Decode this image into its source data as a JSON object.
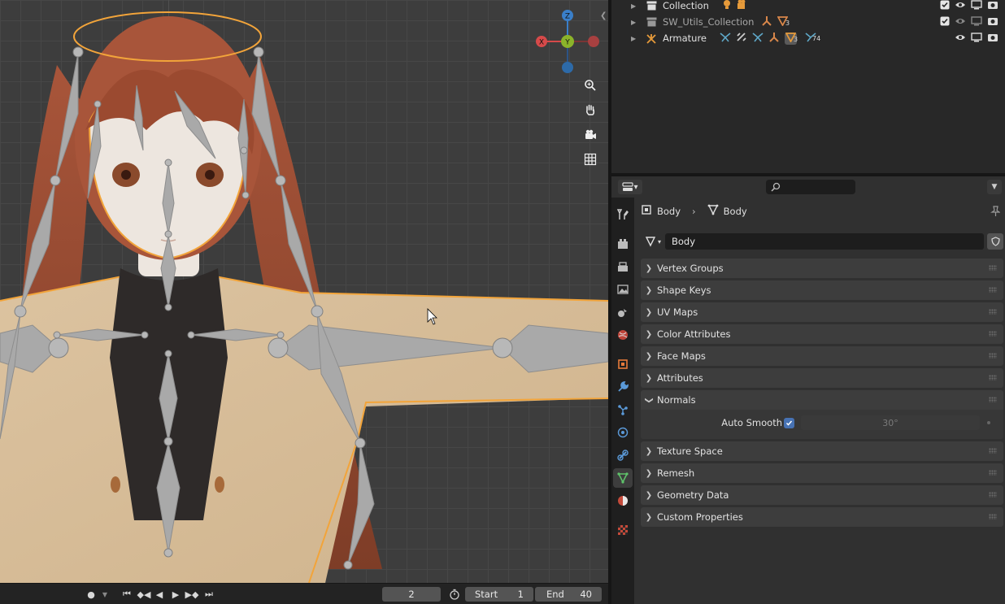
{
  "viewport": {
    "gizmo": {
      "z": "Z",
      "y": "Y",
      "x": "X"
    },
    "axis_colors": {
      "x": "#d64a4a",
      "y": "#8bb32a",
      "z": "#3a7fc9"
    },
    "nav_buttons": [
      "zoom-icon",
      "pan-hand-icon",
      "camera-icon",
      "grid-icon"
    ]
  },
  "timeline": {
    "current_frame": "2",
    "start_label": "Start",
    "start_value": "1",
    "end_label": "End",
    "end_value": "40"
  },
  "outliner": {
    "rows": [
      {
        "label": "Collection",
        "icon": "collection-icon"
      },
      {
        "label": "SW_Utils_Collection",
        "icon": "collection-icon",
        "mod_count": "3"
      },
      {
        "label": "Armature",
        "icon": "armature-icon",
        "mod_count_a": "3",
        "mod_count_b": "74"
      }
    ]
  },
  "properties": {
    "breadcrumb": {
      "object": "Body",
      "data": "Body"
    },
    "mesh_name": "Body",
    "panels": [
      {
        "label": "Vertex Groups",
        "open": false
      },
      {
        "label": "Shape Keys",
        "open": false
      },
      {
        "label": "UV Maps",
        "open": false
      },
      {
        "label": "Color Attributes",
        "open": false
      },
      {
        "label": "Face Maps",
        "open": false
      },
      {
        "label": "Attributes",
        "open": false
      },
      {
        "label": "Normals",
        "open": true
      },
      {
        "label": "Texture Space",
        "open": false
      },
      {
        "label": "Remesh",
        "open": false
      },
      {
        "label": "Geometry Data",
        "open": false
      },
      {
        "label": "Custom Properties",
        "open": false
      }
    ],
    "normals": {
      "auto_smooth_label": "Auto Smooth",
      "auto_smooth": true,
      "angle": "30°"
    },
    "accent": "#4772b3",
    "selection_color": "#f5a33a"
  }
}
